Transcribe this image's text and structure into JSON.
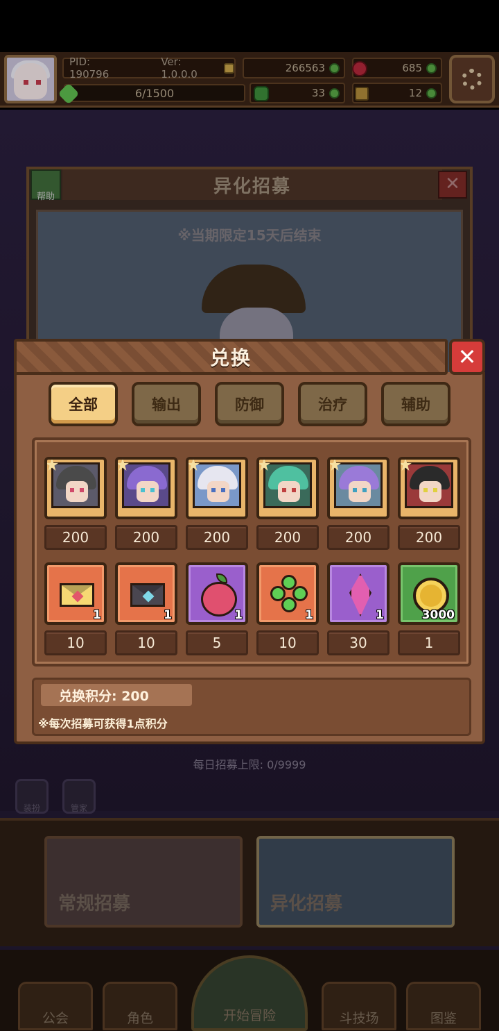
{
  "header": {
    "pid": "PID: 190796",
    "version": "Ver: 1.0.0.0",
    "gold": "266563",
    "gems": "685",
    "exp": "6/1500",
    "clovers": "33",
    "keys": "12"
  },
  "recruit": {
    "title": "异化招募",
    "help_label": "帮助",
    "close_label": "✕",
    "limited_note": "※当期限定15天后结束",
    "daily_limit": "每日招募上限: 0/9999",
    "side_buttons": [
      "装扮",
      "管家"
    ],
    "banners": [
      "常规招募",
      "异化招募"
    ]
  },
  "nav": {
    "items": [
      "公会",
      "角色",
      "开始冒险",
      "斗技场",
      "图鉴"
    ]
  },
  "exchange": {
    "title": "兑换",
    "close_label": "✕",
    "tabs": [
      "全部",
      "输出",
      "防御",
      "治疗",
      "辅助"
    ],
    "active_tab": "全部",
    "heroes": [
      {
        "price": "200",
        "hair": "#4a4a4a",
        "bg": "#5c5a6a",
        "eye": "#d04a6a"
      },
      {
        "price": "200",
        "hair": "#8a6ad0",
        "bg": "#5a4a8a",
        "eye": "#4ac0d0"
      },
      {
        "price": "200",
        "hair": "#e6e6f0",
        "bg": "#7a98c8",
        "eye": "#4a70c0"
      },
      {
        "price": "200",
        "hair": "#4fc0a0",
        "bg": "#3a6a5a",
        "eye": "#c04040"
      },
      {
        "price": "200",
        "hair": "#9a7ad8",
        "bg": "#6a8aa0",
        "eye": "#40a0c0"
      },
      {
        "price": "200",
        "hair": "#2a2a2a",
        "bg": "#9a3a3a",
        "eye": "#e0d040"
      }
    ],
    "items": [
      {
        "icon": "yellow-envelope-icon",
        "qty": "1",
        "price": "10"
      },
      {
        "icon": "dark-envelope-icon",
        "qty": "1",
        "price": "10"
      },
      {
        "icon": "peach-fruit-icon",
        "qty": "1",
        "price": "5"
      },
      {
        "icon": "four-leaf-clover-icon",
        "qty": "1",
        "price": "10"
      },
      {
        "icon": "purple-crystal-icon",
        "qty": "1",
        "price": "30"
      },
      {
        "icon": "gold-coin-icon",
        "qty": "3000",
        "price": "1"
      }
    ],
    "points_label": "兑换积分: 200",
    "points_note": "※每次招募可获得1点积分"
  }
}
